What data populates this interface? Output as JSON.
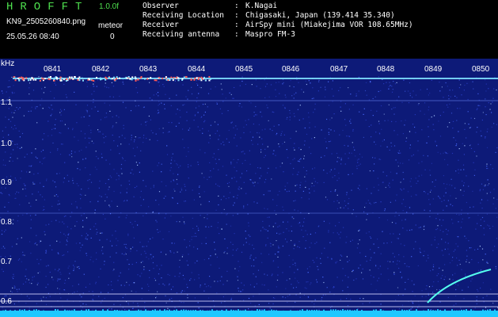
{
  "header": {
    "app_title": "HROFFT",
    "version": "1.0.0f",
    "filename": "KN9_2505260840.png",
    "meteor_label": "meteor",
    "datetime": "25.05.26 08:40",
    "meteor_count": "0",
    "info": [
      {
        "label": "Observer",
        "sep": ":",
        "value": "K.Nagai"
      },
      {
        "label": "Receiving Location",
        "sep": ":",
        "value": "Chigasaki, Japan (139.414 35.340)"
      },
      {
        "label": "Receiver",
        "sep": ":",
        "value": "AirSpy mini (Miakejima VOR 108.65MHz)"
      },
      {
        "label": "Receiving antenna",
        "sep": ":",
        "value": "Maspro FM-3"
      }
    ]
  },
  "spectrogram": {
    "y_unit": "kHz",
    "y_ticks": [
      "1.1",
      "1.0",
      "0.9",
      "0.8",
      "0.7",
      "0.6"
    ],
    "time_ticks": [
      "0841",
      "0842",
      "0843",
      "0844",
      "0845",
      "0846",
      "0847",
      "0848",
      "0849",
      "0850"
    ],
    "colors": {
      "background": "#0d1a78",
      "noise_light": "#4a6cff",
      "carrier": "#7fe0ff",
      "burst": "#ff5a5a",
      "meteor_trail": "#55ffee",
      "reference_line": "#d8d8ff",
      "bottom_band": "#1ec8ff"
    }
  }
}
